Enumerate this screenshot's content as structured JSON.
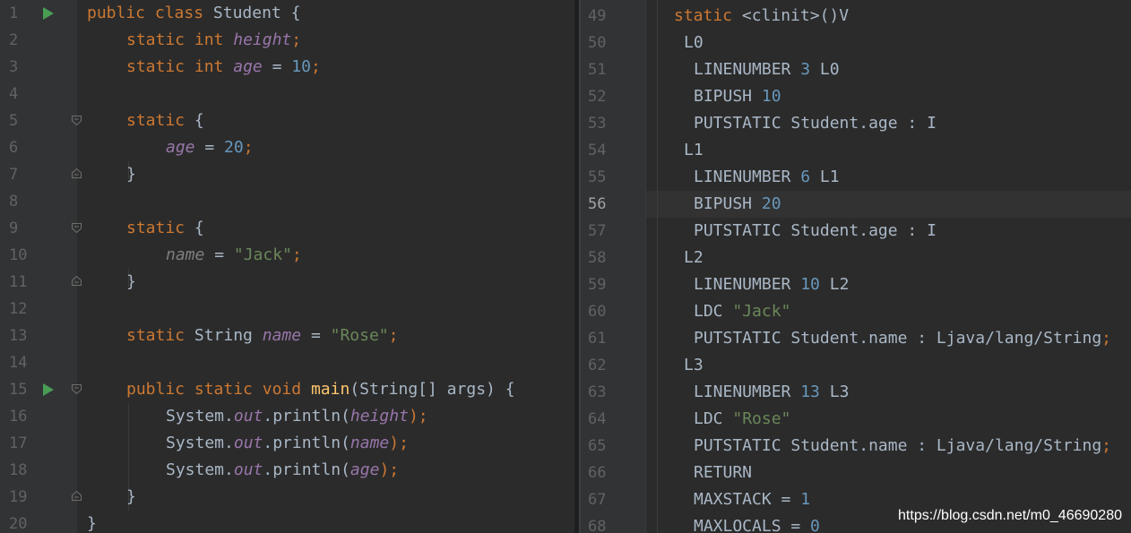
{
  "left_editor": {
    "line_numbers": [
      "1",
      "2",
      "3",
      "4",
      "5",
      "6",
      "7",
      "8",
      "9",
      "10",
      "11",
      "12",
      "13",
      "14",
      "15",
      "16",
      "17",
      "18",
      "19",
      "20"
    ],
    "lines": {
      "l1": {
        "kw1": "public",
        "kw2": "class",
        "name": "Student",
        "brace": " {"
      },
      "l2": {
        "kw1": "static",
        "kw2": "int",
        "field": "height",
        "semi": ";"
      },
      "l3": {
        "kw1": "static",
        "kw2": "int",
        "field": "age",
        "eq": " = ",
        "num": "10",
        "semi": ";"
      },
      "l5": {
        "kw1": "static",
        "brace": " {"
      },
      "l6": {
        "field": "age",
        "eq": " = ",
        "num": "20",
        "semi": ";"
      },
      "l7": {
        "brace": "}"
      },
      "l9": {
        "kw1": "static",
        "brace": " {"
      },
      "l10": {
        "field": "name",
        "eq": " = ",
        "str": "\"Jack\"",
        "semi": ";"
      },
      "l11": {
        "brace": "}"
      },
      "l13": {
        "kw1": "static",
        "type": "String",
        "field": "name",
        "eq": " = ",
        "str": "\"Rose\"",
        "semi": ";"
      },
      "l15": {
        "kw1": "public",
        "kw2": "static",
        "kw3": "void",
        "fn": "main",
        "params": "(String[] args) {"
      },
      "l16": {
        "obj": "System.",
        "sf": "out",
        "call": ".println(",
        "arg": "height",
        "end": ");"
      },
      "l17": {
        "obj": "System.",
        "sf": "out",
        "call": ".println(",
        "arg": "name",
        "end": ");"
      },
      "l18": {
        "obj": "System.",
        "sf": "out",
        "call": ".println(",
        "arg": "age",
        "end": ");"
      },
      "l19": {
        "brace": "}"
      },
      "l20": {
        "brace": "}"
      }
    }
  },
  "right_editor": {
    "line_numbers": [
      "49",
      "50",
      "51",
      "52",
      "53",
      "54",
      "55",
      "56",
      "57",
      "58",
      "59",
      "60",
      "61",
      "62",
      "63",
      "64",
      "65",
      "66",
      "67",
      "68"
    ],
    "current_line": "56",
    "lines": {
      "r49": {
        "kw": "static",
        "rest": " <clinit>()V"
      },
      "r50": {
        "text": "L0"
      },
      "r51": {
        "op": "LINENUMBER",
        "num": "3",
        "label": "L0"
      },
      "r52": {
        "op": "BIPUSH",
        "num": "10"
      },
      "r53": {
        "text": "PUTSTATIC Student.age : I"
      },
      "r54": {
        "text": "L1"
      },
      "r55": {
        "op": "LINENUMBER",
        "num": "6",
        "label": "L1"
      },
      "r56": {
        "op": "BIPUSH",
        "num": "20"
      },
      "r57": {
        "text": "PUTSTATIC Student.age : I"
      },
      "r58": {
        "text": "L2"
      },
      "r59": {
        "op": "LINENUMBER",
        "num": "10",
        "label": "L2"
      },
      "r60": {
        "op": "LDC",
        "str": "\"Jack\""
      },
      "r61": {
        "text": "PUTSTATIC Student.name : Ljava/lang/String",
        "semi": ";"
      },
      "r62": {
        "text": "L3"
      },
      "r63": {
        "op": "LINENUMBER",
        "num": "13",
        "label": "L3"
      },
      "r64": {
        "op": "LDC",
        "str": "\"Rose\""
      },
      "r65": {
        "text": "PUTSTATIC Student.name : Ljava/lang/String",
        "semi": ";"
      },
      "r66": {
        "text": "RETURN"
      },
      "r67": {
        "text": "MAXSTACK = ",
        "num": "1"
      },
      "r68": {
        "text": "MAXLOCALS = ",
        "num": "0"
      }
    }
  },
  "watermark": "https://blog.csdn.net/m0_46690280",
  "colors": {
    "background": "#2b2b2b",
    "keyword": "#cc7832",
    "field": "#9876aa",
    "number": "#6897bb",
    "string": "#6a8759",
    "method": "#ffc66d",
    "plain": "#a9b7c6"
  }
}
